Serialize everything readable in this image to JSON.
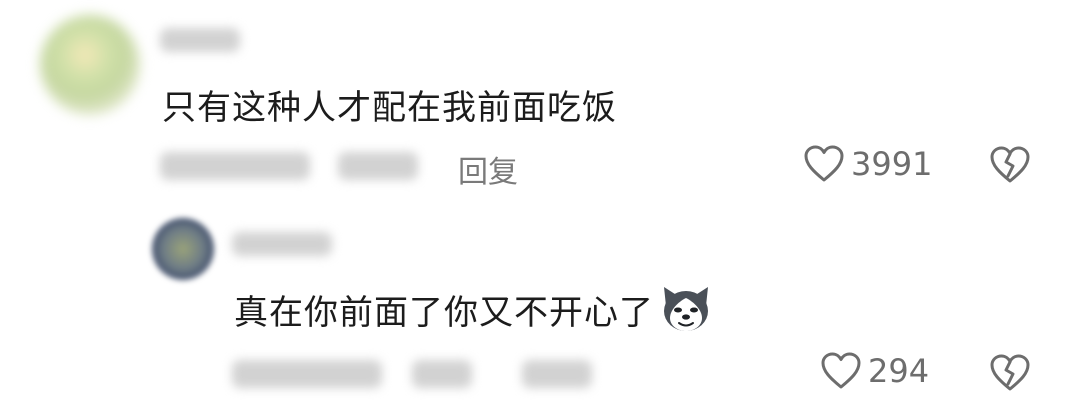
{
  "comments": [
    {
      "text": "只有这种人才配在我前面吃饭",
      "reply_label": "回复",
      "likes": "3991",
      "icons": {
        "like": "heart-outline-icon",
        "dislike": "broken-heart-icon"
      }
    },
    {
      "text": "真在你前面了你又不开心了",
      "emoji": "husky-dog-emoji",
      "likes": "294",
      "icons": {
        "like": "heart-outline-icon",
        "dislike": "broken-heart-icon"
      }
    }
  ],
  "colors": {
    "text": "#1c1c1c",
    "muted": "#7a7a7a",
    "icon": "#6d6d6d",
    "background": "#ffffff"
  }
}
